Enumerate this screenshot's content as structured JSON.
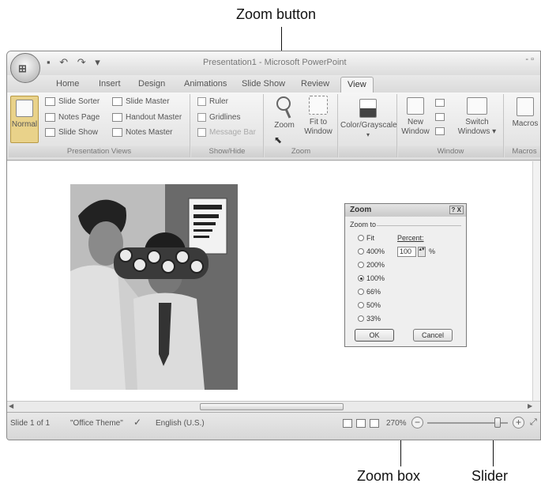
{
  "callouts": {
    "zoom_button": "Zoom button",
    "zoom_box": "Zoom box",
    "slider": "Slider"
  },
  "window": {
    "title": "Presentation1 - Microsoft PowerPoint",
    "controls": "- ▫"
  },
  "tabs": [
    "Home",
    "Insert",
    "Design",
    "Animations",
    "Slide Show",
    "Review",
    "View"
  ],
  "active_tab": "View",
  "ribbon": {
    "presentation_views": {
      "label": "Presentation Views",
      "normal": "Normal",
      "slide_sorter": "Slide Sorter",
      "notes_page": "Notes Page",
      "slide_show": "Slide Show",
      "slide_master": "Slide Master",
      "handout_master": "Handout Master",
      "notes_master": "Notes Master"
    },
    "show_hide": {
      "label": "Show/Hide",
      "ruler": "Ruler",
      "gridlines": "Gridlines",
      "message_bar": "Message Bar"
    },
    "zoom": {
      "label": "Zoom",
      "zoom": "Zoom",
      "fit_to_window_1": "Fit to",
      "fit_to_window_2": "Window"
    },
    "color": {
      "color_grayscale": "Color/Grayscale"
    },
    "window": {
      "label": "Window",
      "new_window_1": "New",
      "new_window_2": "Window",
      "switch_windows_1": "Switch",
      "switch_windows_2": "Windows"
    },
    "macros": {
      "label": "Macros",
      "macros": "Macros"
    }
  },
  "dialog": {
    "title": "Zoom",
    "title_controls": "? X",
    "zoom_to": "Zoom to",
    "percent_label": "Percent:",
    "percent_value": "100",
    "percent_unit": "%",
    "options": [
      "Fit",
      "400%",
      "200%",
      "100%",
      "66%",
      "50%",
      "33%"
    ],
    "selected": "100%",
    "ok": "OK",
    "cancel": "Cancel"
  },
  "status": {
    "slide": "Slide 1 of 1",
    "theme": "\"Office Theme\"",
    "language": "English (U.S.)",
    "zoom_level": "270%",
    "zoom_fraction": 0.9
  }
}
